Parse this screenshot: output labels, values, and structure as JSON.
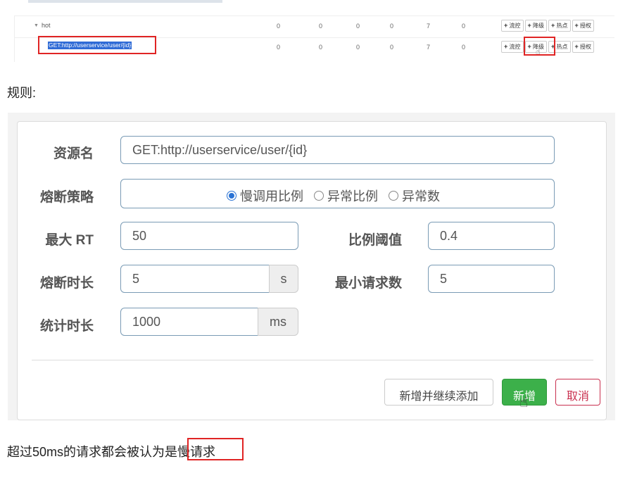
{
  "table": {
    "row1": {
      "name": "hot",
      "values": [
        "0",
        "0",
        "0",
        "0",
        "7",
        "0"
      ]
    },
    "row2": {
      "name": "GET:http://userservice/user/{id}",
      "values": [
        "0",
        "0",
        "0",
        "0",
        "7",
        "0"
      ]
    },
    "actions": [
      "流控",
      "降级",
      "热点",
      "授权"
    ]
  },
  "rules_label": "规则:",
  "form": {
    "resource_label": "资源名",
    "resource_value": "GET:http://userservice/user/{id}",
    "strategy_label": "熔断策略",
    "strategies": [
      "慢调用比例",
      "异常比例",
      "异常数"
    ],
    "selected_strategy": "慢调用比例",
    "max_rt_label": "最大 RT",
    "max_rt_value": "50",
    "ratio_label": "比例阈值",
    "ratio_value": "0.4",
    "break_time_label": "熔断时长",
    "break_time_value": "5",
    "break_time_unit": "s",
    "min_req_label": "最小请求数",
    "min_req_value": "5",
    "stat_time_label": "统计时长",
    "stat_time_value": "1000",
    "stat_time_unit": "ms",
    "btn_continue": "新增并继续添加",
    "btn_add": "新增",
    "btn_cancel": "取消"
  },
  "bottom_text": "超过50ms的请求都会被认为是慢请求",
  "colors": {
    "primary_green": "#3cb04a",
    "highlight_red": "#e02424",
    "cancel_red": "#c9304f",
    "radio_blue": "#2a72d4"
  }
}
